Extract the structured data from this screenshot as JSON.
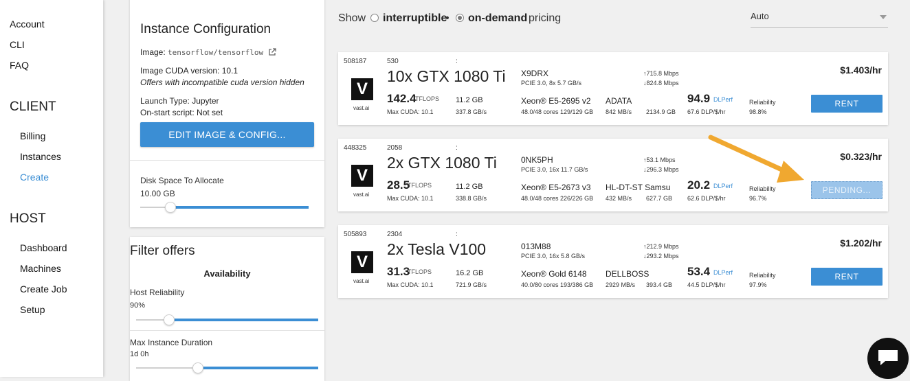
{
  "nav": {
    "top_links": [
      "Account",
      "CLI",
      "FAQ"
    ],
    "client_header": "CLIENT",
    "client_links": [
      "Billing",
      "Instances",
      "Create"
    ],
    "host_header": "HOST",
    "host_links": [
      "Dashboard",
      "Machines",
      "Create Job",
      "Setup"
    ],
    "active": "Create",
    "accent_color": "#3b8ed4"
  },
  "config": {
    "title": "Instance Configuration",
    "image_label": "Image:",
    "image_value": "tensorflow/tensorflow",
    "image_link_icon": "external-link-icon",
    "cuda_label": "Image CUDA version:",
    "cuda_value": "10.1",
    "cuda_note": "Offers with incompatible cuda version hidden",
    "launch_label": "Launch Type:",
    "launch_value": "Jupyter",
    "onstart_label": "On-start script:",
    "onstart_value": "Not set",
    "edit_button": "EDIT IMAGE & CONFIG...",
    "disk_label": "Disk Space To Allocate",
    "disk_value": "10.00 GB",
    "disk_level": 0.18
  },
  "filters": {
    "title": "Filter offers",
    "availability": "Availability",
    "host_rel_label": "Host Reliability",
    "host_rel_value": "90%",
    "host_rel_level": 0.18,
    "max_dur_label": "Max Instance Duration",
    "max_dur_value": "1d 0h",
    "max_dur_level": 0.34
  },
  "pricing": {
    "show": "Show",
    "interruptible": "interruptible",
    "bullet": "•",
    "on_demand": "on-demand",
    "pricing_word": "pricing",
    "selected": "on-demand",
    "sort_value": "Auto"
  },
  "offers": [
    {
      "id": "508187",
      "num": "530",
      "colon": ":",
      "logo": "V",
      "logo_caption": "vast.ai",
      "gpu": "10x GTX 1080 Ti",
      "tflops": "142.4",
      "tflops_unit": "TFLOPS",
      "max_cuda": "Max CUDA: 10.1",
      "vram": "11.2 GB",
      "vram_bw": "337.8 GB/s",
      "host": "X9DRX",
      "pcie": "PCIE 3.0, 8x     5.7 GB/s",
      "cpu": "Xeon® E5-2695 v2",
      "cores": "48.0/48 cores  129/129 GB",
      "disk": "ADATA",
      "disk_speed": "842 MB/s",
      "disk_size": "2134.9 GB",
      "net_up": "↑715.8 Mbps",
      "net_down": "↓824.8 Mbps",
      "dlperf": "94.9",
      "dlperf_unit": "DLPerf",
      "dlperf_per_dollar": "67.6 DLP/$/hr",
      "rel_label": "Reliability",
      "rel_value": "98.8%",
      "price": "$1.403/hr",
      "button": "RENT",
      "pending": false
    },
    {
      "id": "448325",
      "num": "2058",
      "colon": ":",
      "logo": "V",
      "logo_caption": "vast.ai",
      "gpu": "2x GTX 1080 Ti",
      "tflops": "28.5",
      "tflops_unit": "TFLOPS",
      "max_cuda": "Max CUDA: 10.1",
      "vram": "11.2 GB",
      "vram_bw": "338.8 GB/s",
      "host": "0NK5PH",
      "pcie": "PCIE 3.0, 16x   11.7 GB/s",
      "cpu": "Xeon® E5-2673 v3",
      "cores": "48.0/48 cores  226/226 GB",
      "disk": "HL-DT-ST Samsu",
      "disk_speed": "432 MB/s",
      "disk_size": "627.7 GB",
      "net_up": "↑53.1 Mbps",
      "net_down": "↓296.3 Mbps",
      "dlperf": "20.2",
      "dlperf_unit": "DLPerf",
      "dlperf_per_dollar": "62.6 DLP/$/hr",
      "rel_label": "Reliability",
      "rel_value": "96.7%",
      "price": "$0.323/hr",
      "button": "PENDING...",
      "pending": true
    },
    {
      "id": "505893",
      "num": "2304",
      "colon": ":",
      "logo": "V",
      "logo_caption": "vast.ai",
      "gpu": "2x Tesla V100",
      "tflops": "31.3",
      "tflops_unit": "TFLOPS",
      "max_cuda": "Max CUDA: 10.1",
      "vram": "16.2 GB",
      "vram_bw": "721.9 GB/s",
      "host": "013M88",
      "pcie": "PCIE 3.0, 16x    5.8 GB/s",
      "cpu": "Xeon® Gold 6148",
      "cores": "40.0/80 cores  193/386 GB",
      "disk": "DELLBOSS",
      "disk_speed": "2929 MB/s",
      "disk_size": "393.4 GB",
      "net_up": "↑212.9 Mbps",
      "net_down": "↓293.2 Mbps",
      "dlperf": "53.4",
      "dlperf_unit": "DLPerf",
      "dlperf_per_dollar": "44.5 DLP/$/hr",
      "rel_label": "Reliability",
      "rel_value": "97.9%",
      "price": "$1.202/hr",
      "button": "RENT",
      "pending": false
    }
  ],
  "annotation": {
    "arrow_color": "#f0a830",
    "points_to": "pending-button"
  },
  "chat": {
    "icon": "chat-bubble-icon"
  }
}
